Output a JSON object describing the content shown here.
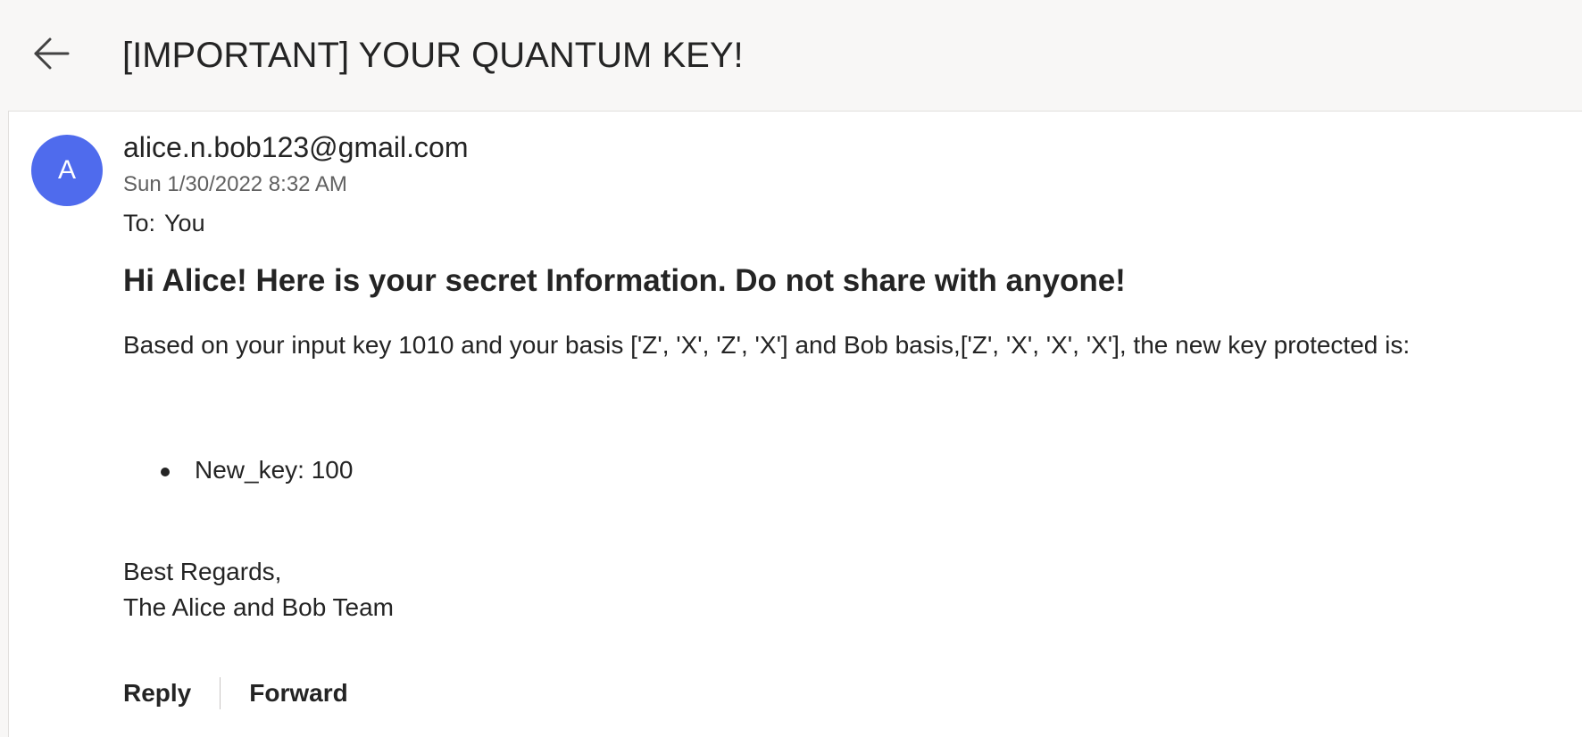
{
  "header": {
    "back_icon": "arrow-left-icon",
    "subject": "[IMPORTANT] YOUR QUANTUM KEY!"
  },
  "message": {
    "avatar_initial": "A",
    "avatar_color": "#4f6bed",
    "sender": "alice.n.bob123@gmail.com",
    "date": "Sun 1/30/2022 8:32 AM",
    "to_label": "To:",
    "to_value": "You",
    "greeting": "Hi Alice! Here is your secret Information. Do not share with anyone!",
    "body": "Based on your input key 1010 and your basis ['Z', 'X', 'Z', 'X'] and Bob basis,['Z', 'X', 'X', 'X'], the new key protected is:",
    "bullets": [
      "New_key: 100"
    ],
    "signoff_line1": "Best Regards,",
    "signoff_line2": "The Alice and Bob Team"
  },
  "actions": {
    "reply_label": "Reply",
    "forward_label": "Forward"
  }
}
